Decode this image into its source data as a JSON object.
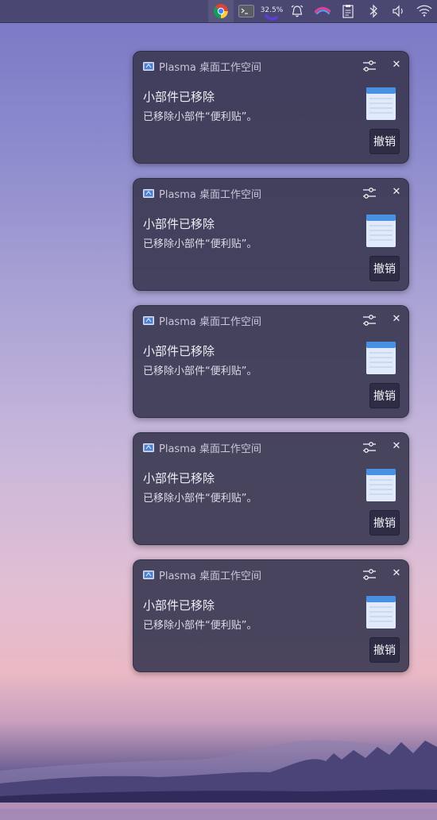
{
  "panel": {
    "battery_label": "32.5%",
    "tray_icons": [
      "chrome-icon",
      "terminal-icon",
      "battery-icon",
      "alarm-icon",
      "krita-brush-icon",
      "clipboard-icon",
      "bluetooth-icon",
      "volume-icon",
      "wifi-icon"
    ]
  },
  "notifications": [
    {
      "app": "Plasma 桌面工作空间",
      "title": "小部件已移除",
      "body": "已移除小部件“便利贴”。",
      "action": "撤销"
    },
    {
      "app": "Plasma 桌面工作空间",
      "title": "小部件已移除",
      "body": "已移除小部件“便利贴”。",
      "action": "撤销"
    },
    {
      "app": "Plasma 桌面工作空间",
      "title": "小部件已移除",
      "body": "已移除小部件“便利贴”。",
      "action": "撤销"
    },
    {
      "app": "Plasma 桌面工作空间",
      "title": "小部件已移除",
      "body": "已移除小部件“便利贴”。",
      "action": "撤销"
    },
    {
      "app": "Plasma 桌面工作空间",
      "title": "小部件已移除",
      "body": "已移除小部件“便利贴”。",
      "action": "撤销"
    }
  ],
  "colors": {
    "note_header": "#4a90e2",
    "note_body": "#dfeafa"
  }
}
